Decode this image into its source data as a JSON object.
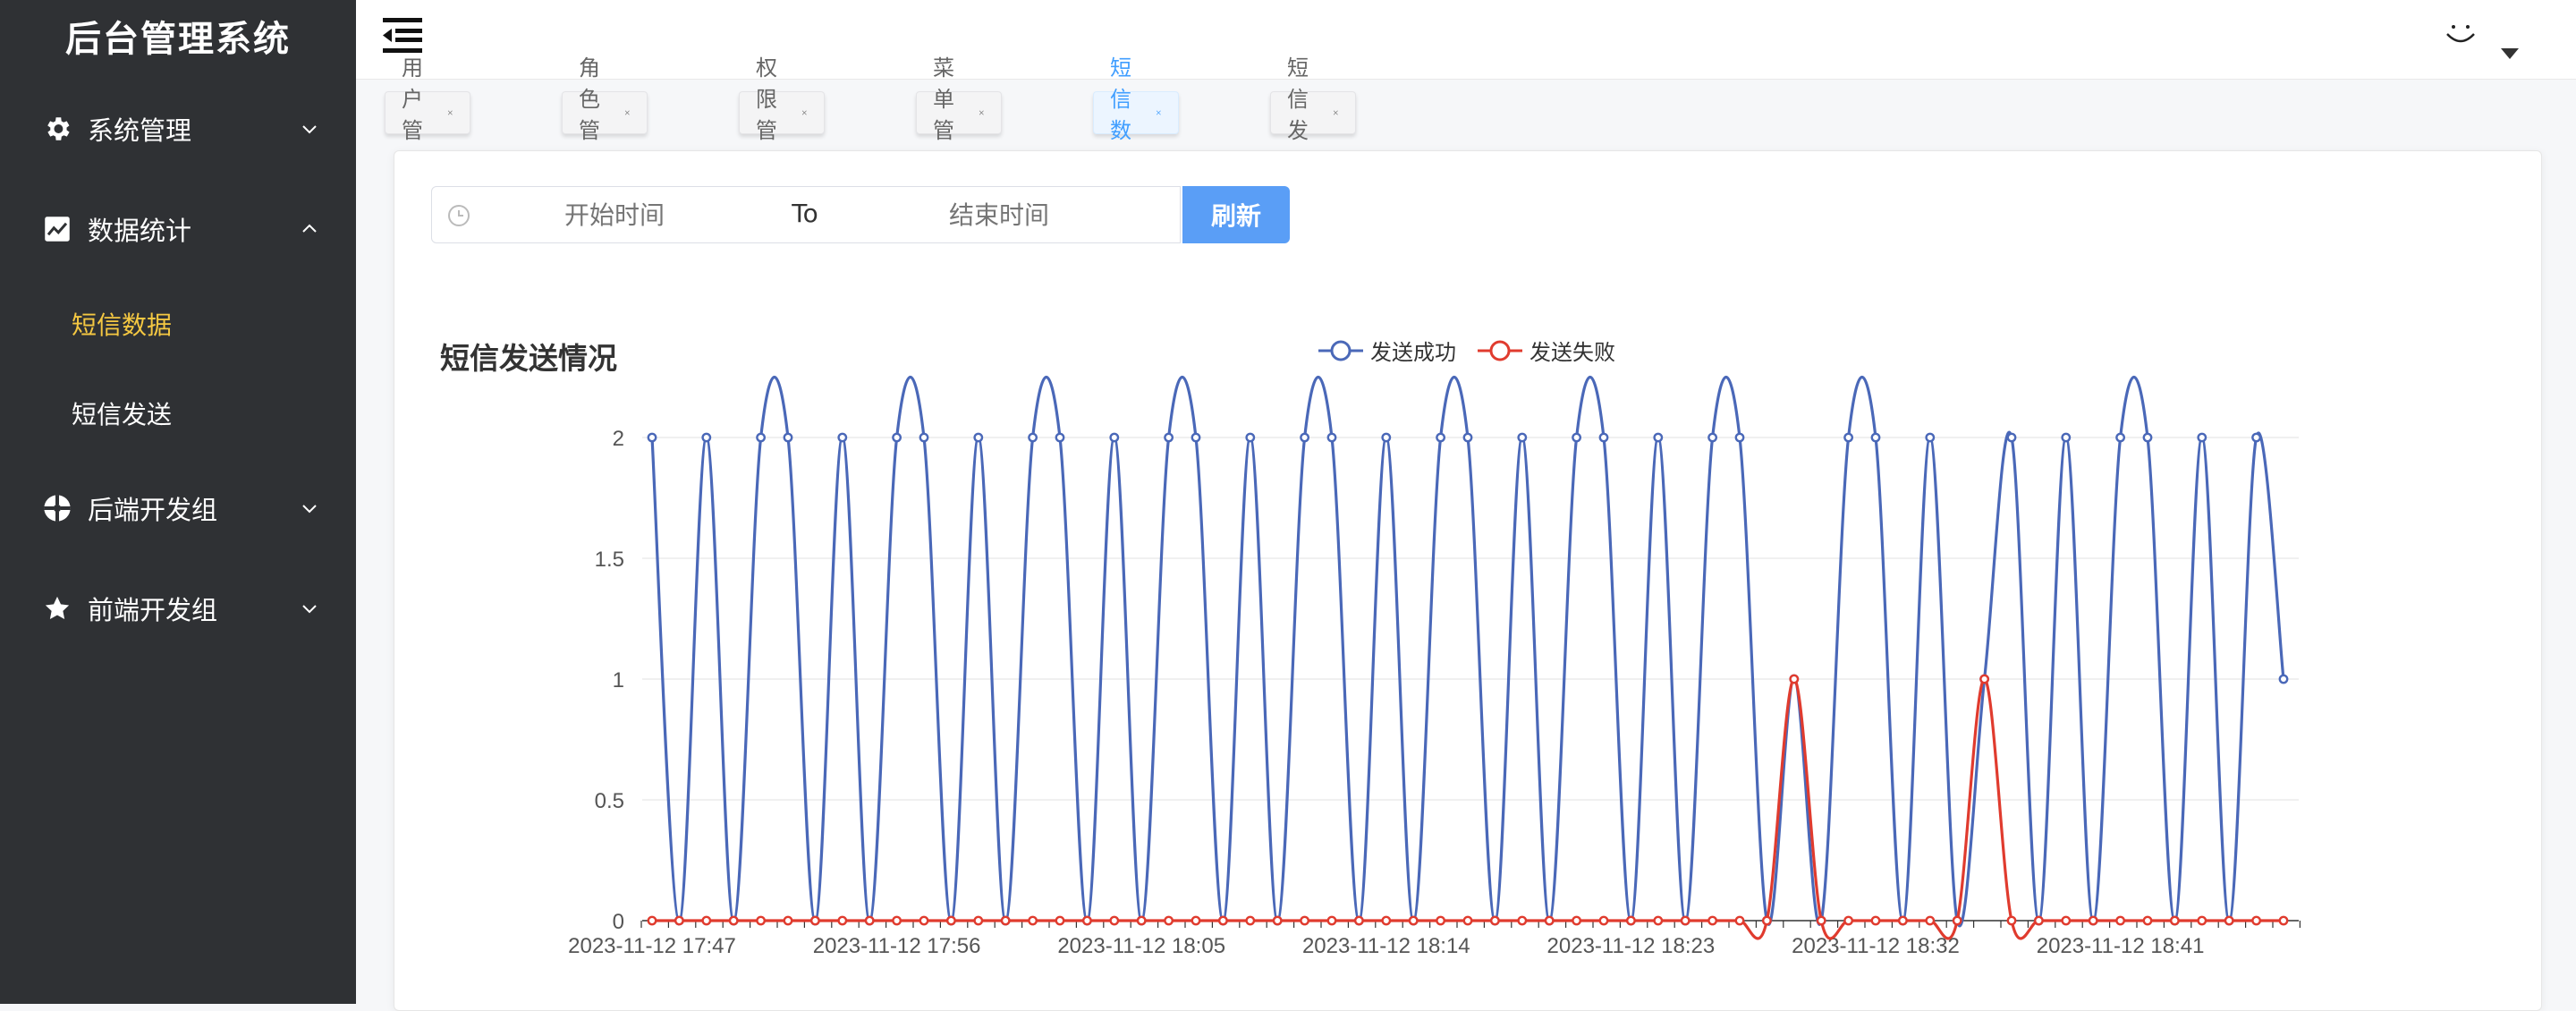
{
  "app": {
    "title": "后台管理系统"
  },
  "sidebar": {
    "items": [
      {
        "label": "系统管理",
        "icon": "gear-icon",
        "expanded": false
      },
      {
        "label": "数据统计",
        "icon": "line-chart-icon",
        "expanded": true,
        "children": [
          {
            "label": "短信数据",
            "active": true
          },
          {
            "label": "短信发送",
            "active": false
          }
        ]
      },
      {
        "label": "后端开发组",
        "icon": "aperture-icon",
        "expanded": false
      },
      {
        "label": "前端开发组",
        "icon": "star-icon",
        "expanded": false
      }
    ]
  },
  "tabs": [
    {
      "label": "用户管理",
      "active": false
    },
    {
      "label": "角色管理",
      "active": false
    },
    {
      "label": "权限管理",
      "active": false
    },
    {
      "label": "菜单管理",
      "active": false
    },
    {
      "label": "短信数据",
      "active": true
    },
    {
      "label": "短信发送",
      "active": false
    }
  ],
  "filter": {
    "start_placeholder": "开始时间",
    "separator": "To",
    "end_placeholder": "结束时间",
    "refresh_label": "刷新"
  },
  "colors": {
    "success": "#4a68b8",
    "failure": "#e03b2e",
    "accent": "#5a9ef6",
    "sidebar_bg": "#2f3134",
    "active_menu": "#f5c842"
  },
  "chart_data": {
    "type": "line",
    "title": "短信发送情况",
    "smooth": true,
    "ylim": [
      0,
      2
    ],
    "yticks": [
      0,
      0.5,
      1,
      1.5,
      2
    ],
    "ytick_labels": [
      "0",
      "0.5",
      "1",
      "1.5",
      "2"
    ],
    "xtick_labels": [
      "2023-11-12 17:47",
      "2023-11-12 17:56",
      "2023-11-12 18:05",
      "2023-11-12 18:14",
      "2023-11-12 18:23",
      "2023-11-12 18:32",
      "2023-11-12 18:41"
    ],
    "legend_position": "top-center",
    "grid": true,
    "series": [
      {
        "name": "发送成功",
        "color": "#4a68b8",
        "values": [
          2,
          0,
          2,
          0,
          2,
          2,
          0,
          2,
          0,
          2,
          2,
          0,
          2,
          0,
          2,
          2,
          0,
          2,
          0,
          2,
          2,
          0,
          2,
          0,
          2,
          2,
          0,
          2,
          0,
          2,
          2,
          0,
          2,
          0,
          2,
          2,
          0,
          2,
          0,
          2,
          2,
          0,
          1,
          0,
          2,
          2,
          0,
          2,
          0,
          1,
          2,
          0,
          2,
          0,
          2,
          2,
          0,
          2,
          0,
          2,
          1
        ]
      },
      {
        "name": "发送失败",
        "color": "#e03b2e",
        "values": [
          0,
          0,
          0,
          0,
          0,
          0,
          0,
          0,
          0,
          0,
          0,
          0,
          0,
          0,
          0,
          0,
          0,
          0,
          0,
          0,
          0,
          0,
          0,
          0,
          0,
          0,
          0,
          0,
          0,
          0,
          0,
          0,
          0,
          0,
          0,
          0,
          0,
          0,
          0,
          0,
          0,
          0,
          1,
          0,
          0,
          0,
          0,
          0,
          0,
          1,
          0,
          0,
          0,
          0,
          0,
          0,
          0,
          0,
          0,
          0,
          0
        ]
      }
    ]
  }
}
